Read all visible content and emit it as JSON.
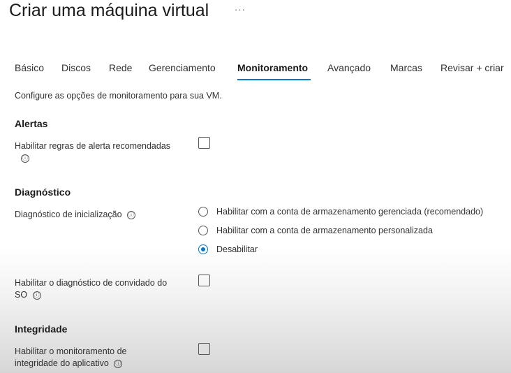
{
  "header": {
    "title": "Criar uma máquina virtual",
    "more": "···"
  },
  "tabs": [
    {
      "label": "Básico"
    },
    {
      "label": "Discos"
    },
    {
      "label": "Rede"
    },
    {
      "label": "Gerenciamento"
    },
    {
      "label": "Monitoramento",
      "active": true
    },
    {
      "label": "Avançado"
    },
    {
      "label": "Marcas"
    },
    {
      "label": "Revisar + criar"
    }
  ],
  "intro": "Configure as opções de monitoramento para sua VM.",
  "alerts": {
    "heading": "Alertas",
    "enable_rules_label": "Habilitar regras de alerta recomendadas",
    "enable_rules_checked": false
  },
  "diagnostics": {
    "heading": "Diagnóstico",
    "boot_label": "Diagnóstico de inicialização",
    "boot_options": [
      {
        "label": "Habilitar com a conta de armazenamento gerenciada (recomendado)",
        "selected": false
      },
      {
        "label": "Habilitar com a conta de armazenamento personalizada",
        "selected": false
      },
      {
        "label": "Desabilitar",
        "selected": true
      }
    ],
    "guest_label_line1": "Habilitar o diagnóstico de convidado do",
    "guest_label_line2": "SO",
    "guest_checked": false
  },
  "integrity": {
    "heading": "Integridade",
    "app_label_line1": "Habilitar o monitoramento de",
    "app_label_line2": "integridade do aplicativo",
    "app_checked": false
  },
  "icons": {
    "info": "ⓘ"
  },
  "colors": {
    "accent": "#0078d4"
  }
}
